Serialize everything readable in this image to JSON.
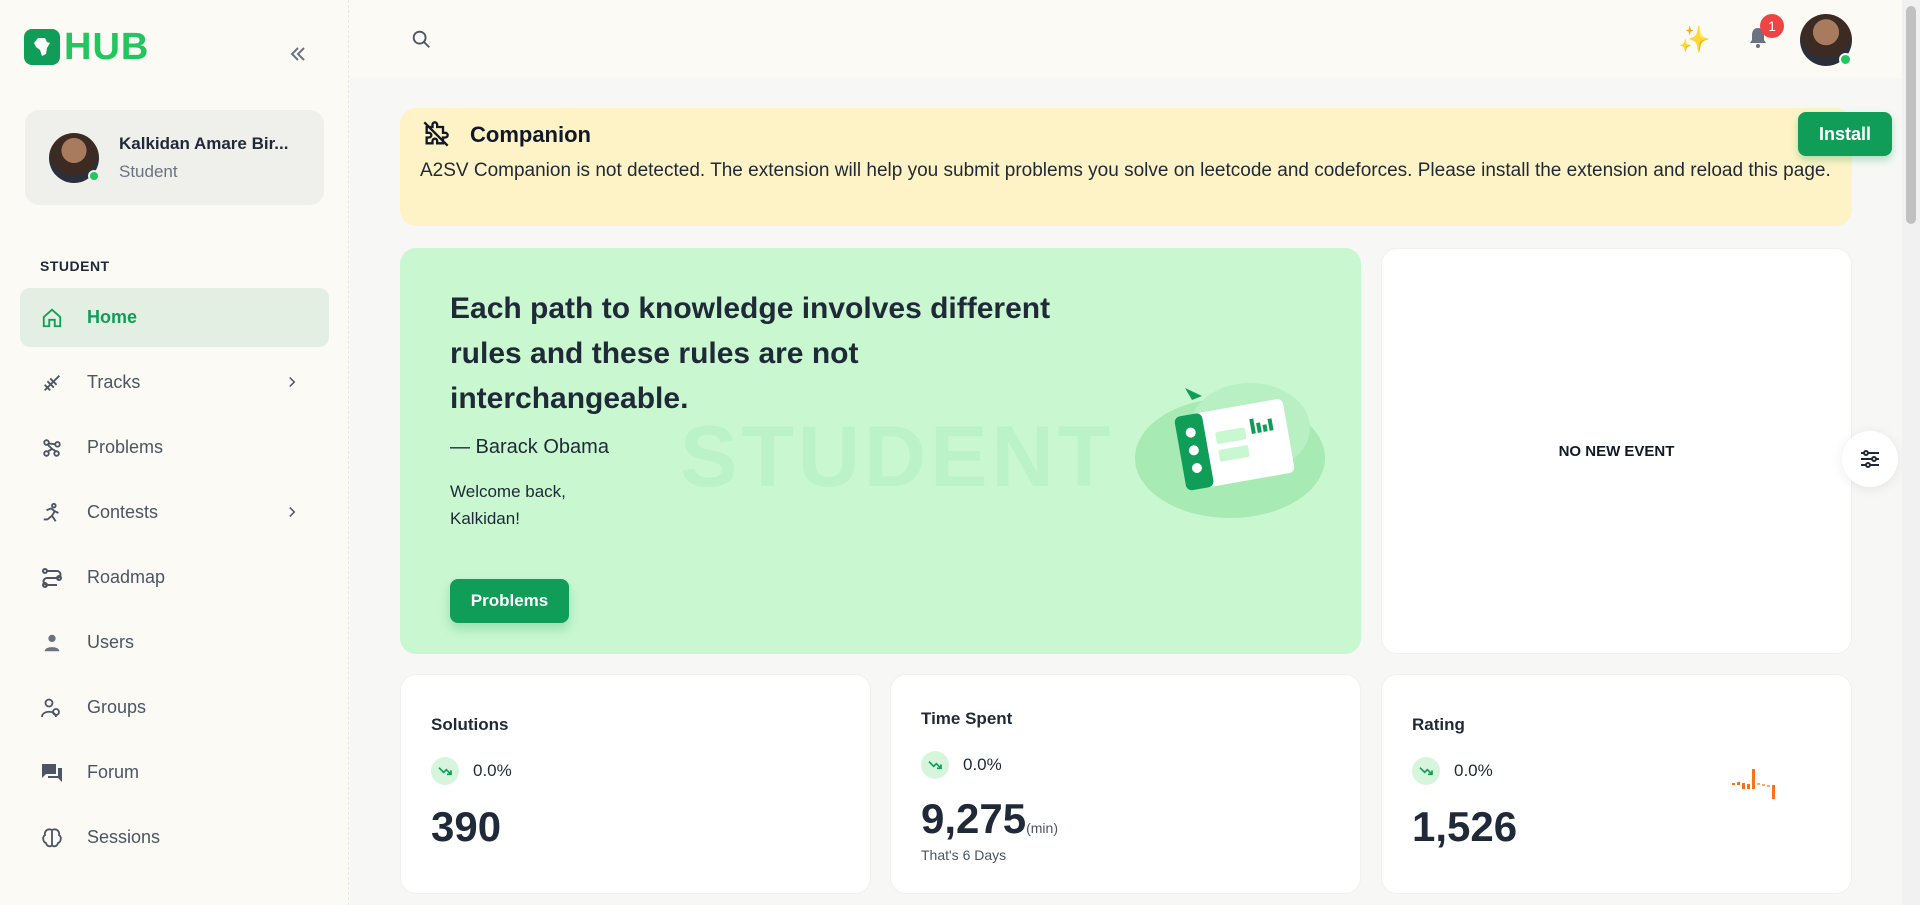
{
  "app": {
    "logo_text": "HUB"
  },
  "user": {
    "name": "Kalkidan Amare Bir...",
    "role": "Student"
  },
  "sidebar": {
    "section_label": "STUDENT",
    "items": [
      {
        "label": "Home",
        "icon": "home-icon",
        "active": true
      },
      {
        "label": "Tracks",
        "icon": "tracks-icon",
        "has_chevron": true
      },
      {
        "label": "Problems",
        "icon": "problems-icon"
      },
      {
        "label": "Contests",
        "icon": "contests-icon",
        "has_chevron": true
      },
      {
        "label": "Roadmap",
        "icon": "roadmap-icon"
      },
      {
        "label": "Users",
        "icon": "user-icon"
      },
      {
        "label": "Groups",
        "icon": "groups-icon"
      },
      {
        "label": "Forum",
        "icon": "forum-icon"
      },
      {
        "label": "Sessions",
        "icon": "brain-icon"
      }
    ]
  },
  "topbar": {
    "notification_count": "1"
  },
  "banner": {
    "title": "Companion",
    "text": "A2SV Companion is not detected. The extension will help you submit problems you solve on leetcode and codeforces. Please install the extension and reload this page.",
    "install_label": "Install"
  },
  "hero": {
    "quote": "Each path to knowledge involves different rules and these rules are not interchangeable.",
    "author": "— Barack Obama",
    "welcome_line1": "Welcome back,",
    "welcome_line2": "Kalkidan!",
    "button_label": "Problems",
    "watermark": "STUDENT"
  },
  "events": {
    "empty_text": "NO NEW EVENT"
  },
  "stats": {
    "solutions": {
      "title": "Solutions",
      "trend": "0.0%",
      "value": "390"
    },
    "time_spent": {
      "title": "Time Spent",
      "trend": "0.0%",
      "value": "9,275",
      "unit": "(min)",
      "sub": "That's 6 Days"
    },
    "rating": {
      "title": "Rating",
      "trend": "0.0%",
      "value": "1,526"
    }
  },
  "colors": {
    "brand": "#0f9d58",
    "accent_light": "#c8f7d0",
    "warning_bg": "#fef3c7",
    "badge": "#ef4444",
    "spark": "#f97316"
  }
}
